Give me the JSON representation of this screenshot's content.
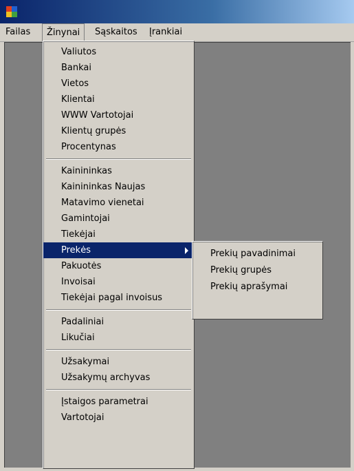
{
  "window": {
    "icon_colors": [
      "#e04020",
      "#2060d0",
      "#f0c020",
      "#40a040"
    ]
  },
  "menubar": {
    "items": [
      {
        "label": "Failas"
      },
      {
        "label": "Žinynai"
      },
      {
        "label": "Sąskaitos"
      },
      {
        "label": "Įrankiai"
      }
    ]
  },
  "dropdown": {
    "groups": [
      [
        "Valiutos",
        "Bankai",
        "Vietos",
        "Klientai",
        "WWW Vartotojai",
        "Klientų grupės",
        "Procentynas"
      ],
      [
        "Kainininkas",
        "Kainininkas Naujas",
        "Matavimo vienetai",
        "Gamintojai",
        "Tiekėjai",
        "Prekės",
        "Pakuotės",
        "Invoisai",
        "Tiekėjai pagal invoisus"
      ],
      [
        "Padaliniai",
        "Likučiai"
      ],
      [
        "Užsakymai",
        "Užsakymų archyvas"
      ],
      [
        "Įstaigos parametrai",
        "Vartotojai"
      ]
    ],
    "selected": "Prekės"
  },
  "submenu": {
    "items": [
      "Prekių pavadinimai",
      "Prekių grupės",
      "Prekių aprašymai"
    ]
  },
  "colors": {
    "selection": "#0a246a",
    "menu_bg": "#d4d0c8",
    "workspace": "#808080"
  }
}
